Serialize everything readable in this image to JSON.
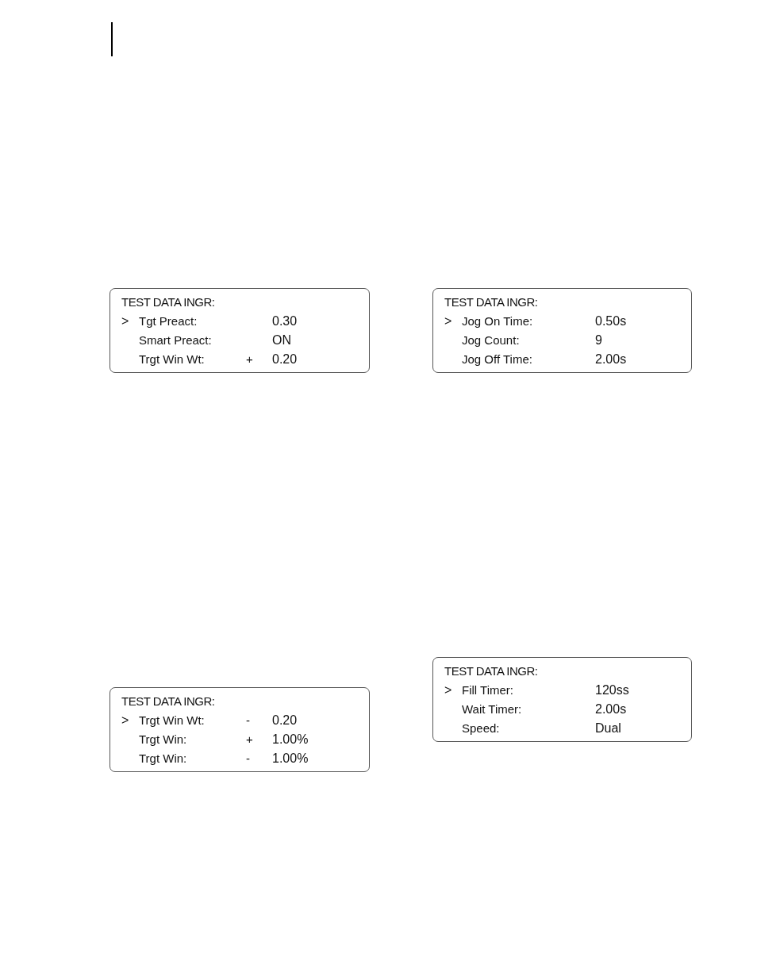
{
  "panels": [
    {
      "title": "TEST DATA INGR:",
      "cursor": ">",
      "rows": [
        {
          "label": "Tgt Preact:",
          "value": "0.30",
          "selected": true
        },
        {
          "label": "Smart Preact:",
          "value": "ON",
          "selected": false
        },
        {
          "label": "Trgt Win Wt:",
          "sign": "+",
          "value": "0.20",
          "selected": false
        }
      ]
    },
    {
      "title": "TEST DATA INGR:",
      "cursor": ">",
      "rows": [
        {
          "label": "Trgt Win Wt:",
          "sign": "-",
          "value": "0.20",
          "selected": true
        },
        {
          "label": "Trgt Win:",
          "sign": "+",
          "value": "1.00%",
          "selected": false
        },
        {
          "label": "Trgt Win:",
          "sign": "-",
          "value": "1.00%",
          "selected": false
        }
      ]
    },
    {
      "title": "TEST DATA INGR:",
      "cursor": ">",
      "rows": [
        {
          "label": "Jog On Time:",
          "value": "0.50s",
          "selected": true
        },
        {
          "label": "Jog Count:",
          "value": "9",
          "selected": false
        },
        {
          "label": "Jog Off Time:",
          "value": "2.00s",
          "selected": false
        }
      ]
    },
    {
      "title": "TEST DATA INGR:",
      "cursor": ">",
      "rows": [
        {
          "label": "Fill Timer:",
          "value": "120ss",
          "selected": true
        },
        {
          "label": "Wait Timer:",
          "value": "2.00s",
          "selected": false
        },
        {
          "label": "Speed:",
          "value": "Dual",
          "selected": false
        }
      ]
    }
  ]
}
